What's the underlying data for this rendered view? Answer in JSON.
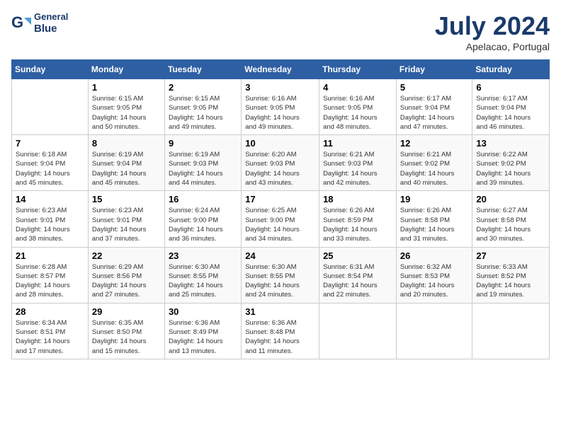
{
  "logo": {
    "line1": "General",
    "line2": "Blue"
  },
  "title": {
    "month_year": "July 2024",
    "location": "Apelacao, Portugal"
  },
  "headers": [
    "Sunday",
    "Monday",
    "Tuesday",
    "Wednesday",
    "Thursday",
    "Friday",
    "Saturday"
  ],
  "weeks": [
    [
      {
        "day": "",
        "info": ""
      },
      {
        "day": "1",
        "info": "Sunrise: 6:15 AM\nSunset: 9:05 PM\nDaylight: 14 hours\nand 50 minutes."
      },
      {
        "day": "2",
        "info": "Sunrise: 6:15 AM\nSunset: 9:05 PM\nDaylight: 14 hours\nand 49 minutes."
      },
      {
        "day": "3",
        "info": "Sunrise: 6:16 AM\nSunset: 9:05 PM\nDaylight: 14 hours\nand 49 minutes."
      },
      {
        "day": "4",
        "info": "Sunrise: 6:16 AM\nSunset: 9:05 PM\nDaylight: 14 hours\nand 48 minutes."
      },
      {
        "day": "5",
        "info": "Sunrise: 6:17 AM\nSunset: 9:04 PM\nDaylight: 14 hours\nand 47 minutes."
      },
      {
        "day": "6",
        "info": "Sunrise: 6:17 AM\nSunset: 9:04 PM\nDaylight: 14 hours\nand 46 minutes."
      }
    ],
    [
      {
        "day": "7",
        "info": "Sunrise: 6:18 AM\nSunset: 9:04 PM\nDaylight: 14 hours\nand 45 minutes."
      },
      {
        "day": "8",
        "info": "Sunrise: 6:19 AM\nSunset: 9:04 PM\nDaylight: 14 hours\nand 45 minutes."
      },
      {
        "day": "9",
        "info": "Sunrise: 6:19 AM\nSunset: 9:03 PM\nDaylight: 14 hours\nand 44 minutes."
      },
      {
        "day": "10",
        "info": "Sunrise: 6:20 AM\nSunset: 9:03 PM\nDaylight: 14 hours\nand 43 minutes."
      },
      {
        "day": "11",
        "info": "Sunrise: 6:21 AM\nSunset: 9:03 PM\nDaylight: 14 hours\nand 42 minutes."
      },
      {
        "day": "12",
        "info": "Sunrise: 6:21 AM\nSunset: 9:02 PM\nDaylight: 14 hours\nand 40 minutes."
      },
      {
        "day": "13",
        "info": "Sunrise: 6:22 AM\nSunset: 9:02 PM\nDaylight: 14 hours\nand 39 minutes."
      }
    ],
    [
      {
        "day": "14",
        "info": "Sunrise: 6:23 AM\nSunset: 9:01 PM\nDaylight: 14 hours\nand 38 minutes."
      },
      {
        "day": "15",
        "info": "Sunrise: 6:23 AM\nSunset: 9:01 PM\nDaylight: 14 hours\nand 37 minutes."
      },
      {
        "day": "16",
        "info": "Sunrise: 6:24 AM\nSunset: 9:00 PM\nDaylight: 14 hours\nand 36 minutes."
      },
      {
        "day": "17",
        "info": "Sunrise: 6:25 AM\nSunset: 9:00 PM\nDaylight: 14 hours\nand 34 minutes."
      },
      {
        "day": "18",
        "info": "Sunrise: 6:26 AM\nSunset: 8:59 PM\nDaylight: 14 hours\nand 33 minutes."
      },
      {
        "day": "19",
        "info": "Sunrise: 6:26 AM\nSunset: 8:58 PM\nDaylight: 14 hours\nand 31 minutes."
      },
      {
        "day": "20",
        "info": "Sunrise: 6:27 AM\nSunset: 8:58 PM\nDaylight: 14 hours\nand 30 minutes."
      }
    ],
    [
      {
        "day": "21",
        "info": "Sunrise: 6:28 AM\nSunset: 8:57 PM\nDaylight: 14 hours\nand 28 minutes."
      },
      {
        "day": "22",
        "info": "Sunrise: 6:29 AM\nSunset: 8:56 PM\nDaylight: 14 hours\nand 27 minutes."
      },
      {
        "day": "23",
        "info": "Sunrise: 6:30 AM\nSunset: 8:55 PM\nDaylight: 14 hours\nand 25 minutes."
      },
      {
        "day": "24",
        "info": "Sunrise: 6:30 AM\nSunset: 8:55 PM\nDaylight: 14 hours\nand 24 minutes."
      },
      {
        "day": "25",
        "info": "Sunrise: 6:31 AM\nSunset: 8:54 PM\nDaylight: 14 hours\nand 22 minutes."
      },
      {
        "day": "26",
        "info": "Sunrise: 6:32 AM\nSunset: 8:53 PM\nDaylight: 14 hours\nand 20 minutes."
      },
      {
        "day": "27",
        "info": "Sunrise: 6:33 AM\nSunset: 8:52 PM\nDaylight: 14 hours\nand 19 minutes."
      }
    ],
    [
      {
        "day": "28",
        "info": "Sunrise: 6:34 AM\nSunset: 8:51 PM\nDaylight: 14 hours\nand 17 minutes."
      },
      {
        "day": "29",
        "info": "Sunrise: 6:35 AM\nSunset: 8:50 PM\nDaylight: 14 hours\nand 15 minutes."
      },
      {
        "day": "30",
        "info": "Sunrise: 6:36 AM\nSunset: 8:49 PM\nDaylight: 14 hours\nand 13 minutes."
      },
      {
        "day": "31",
        "info": "Sunrise: 6:36 AM\nSunset: 8:48 PM\nDaylight: 14 hours\nand 11 minutes."
      },
      {
        "day": "",
        "info": ""
      },
      {
        "day": "",
        "info": ""
      },
      {
        "day": "",
        "info": ""
      }
    ]
  ]
}
